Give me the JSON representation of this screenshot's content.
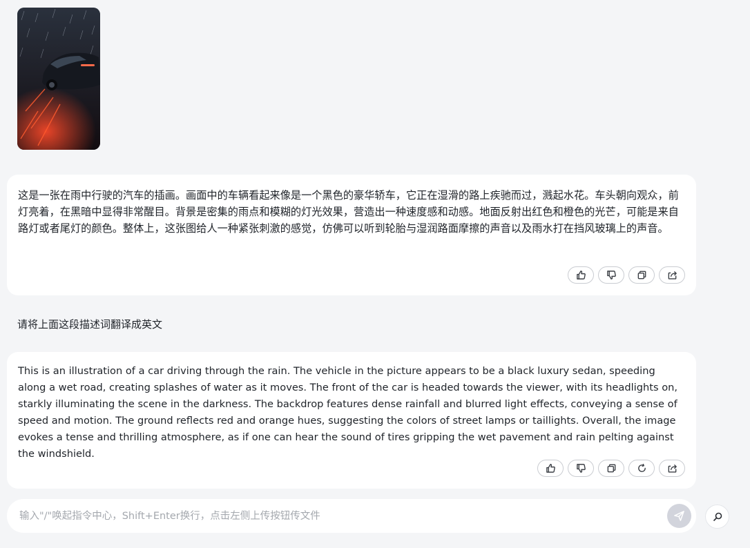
{
  "conversation": {
    "assistant_reply_1": "这是一张在雨中行驶的汽车的插画。画面中的车辆看起来像是一个黑色的豪华轿车，它正在湿滑的路上疾驰而过，溅起水花。车头朝向观众，前灯亮着，在黑暗中显得非常醒目。背景是密集的雨点和模糊的灯光效果，营造出一种速度感和动感。地面反射出红色和橙色的光芒，可能是来自路灯或者尾灯的颜色。整体上，这张图给人一种紧张刺激的感觉，仿佛可以听到轮胎与湿润路面摩擦的声音以及雨水打在挡风玻璃上的声音。",
    "user_message": "请将上面这段描述词翻译成英文",
    "assistant_reply_2": "This is an illustration of a car driving through the rain. The vehicle in the picture appears to be a black luxury sedan, speeding along a wet road, creating splashes of water as it moves. The front of the car is headed towards the viewer, with its headlights on, starkly illuminating the scene in the darkness. The backdrop features dense rainfall and blurred light effects, conveying a sense of speed and motion. The ground reflects red and orange hues, suggesting the colors of street lamps or taillights. Overall, the image evokes a tense and thrilling atmosphere, as if one can hear the sound of tires gripping the wet pavement and rain pelting against the windshield."
  },
  "message_actions": {
    "reply_1": [
      "thumbs-up-icon",
      "thumbs-down-icon",
      "copy-icon",
      "share-icon"
    ],
    "reply_2": [
      "thumbs-up-icon",
      "thumbs-down-icon",
      "copy-icon",
      "regenerate-icon",
      "share-icon"
    ]
  },
  "input": {
    "placeholder": "输入\"/\"唤起指令中心，Shift+Enter换行，点击左侧上传按钮传文件",
    "value": ""
  },
  "colors": {
    "background": "#f4f5f7",
    "card": "#ffffff",
    "send_button": "#d2d4dc",
    "text": "#1f2329",
    "placeholder": "#a4a8ae"
  }
}
